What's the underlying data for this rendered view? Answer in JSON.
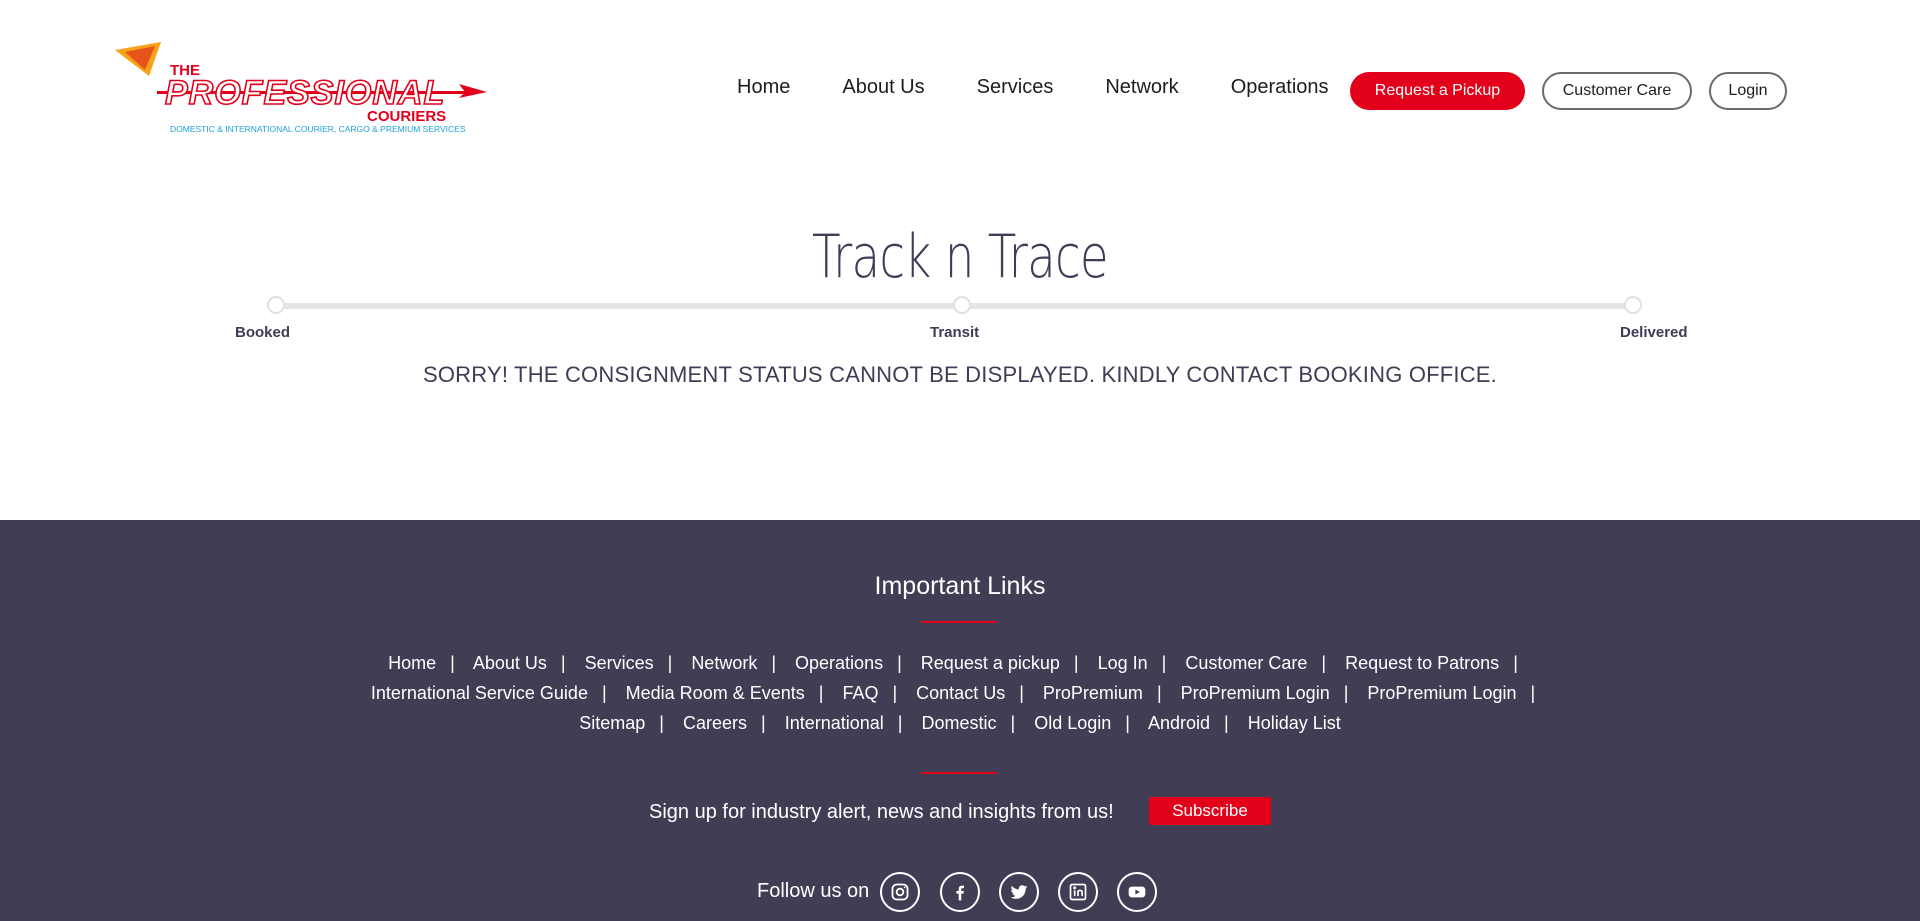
{
  "logo": {
    "top_text": "THE",
    "main_text": "PROFESSIONAL",
    "sub_text": "COURIERS",
    "tagline": "DOMESTIC & INTERNATIONAL   COURIER, CARGO & PREMIUM SERVICES"
  },
  "nav": {
    "items": [
      "Home",
      "About Us",
      "Services",
      "Network",
      "Operations"
    ],
    "pickup_label": "Request a Pickup",
    "care_label": "Customer Care",
    "login_label": "Login"
  },
  "track": {
    "title": "Track n Trace",
    "stages": [
      "Booked",
      "Transit",
      "Delivered"
    ],
    "message": "SORRY! THE CONSIGNMENT STATUS CANNOT BE DISPLAYED. KINDLY CONTACT BOOKING OFFICE."
  },
  "footer": {
    "title": "Important Links",
    "link_rows": [
      [
        "Home",
        "About Us",
        "Services",
        "Network",
        "Operations",
        "Request a pickup",
        "Log In",
        "Customer Care",
        "Request to Patrons"
      ],
      [
        "International Service Guide",
        "Media Room & Events",
        "FAQ",
        "Contact Us",
        "ProPremium",
        "ProPremium Login",
        "ProPremium Login"
      ],
      [
        "Sitemap",
        "Careers",
        "International",
        "Domestic",
        "Old Login",
        "Android",
        "Holiday List"
      ]
    ],
    "signup_text": "Sign up for industry alert, news and insights from us!",
    "subscribe_label": "Subscribe",
    "follow_text": "Follow us on",
    "social": [
      "instagram-icon",
      "facebook-icon",
      "twitter-icon",
      "linkedin-icon",
      "youtube-icon"
    ]
  },
  "colors": {
    "accent": "#e3001b",
    "footer_bg": "#403d55",
    "text_dark": "#3f3c55",
    "logo_blue": "#1fa1dd"
  }
}
